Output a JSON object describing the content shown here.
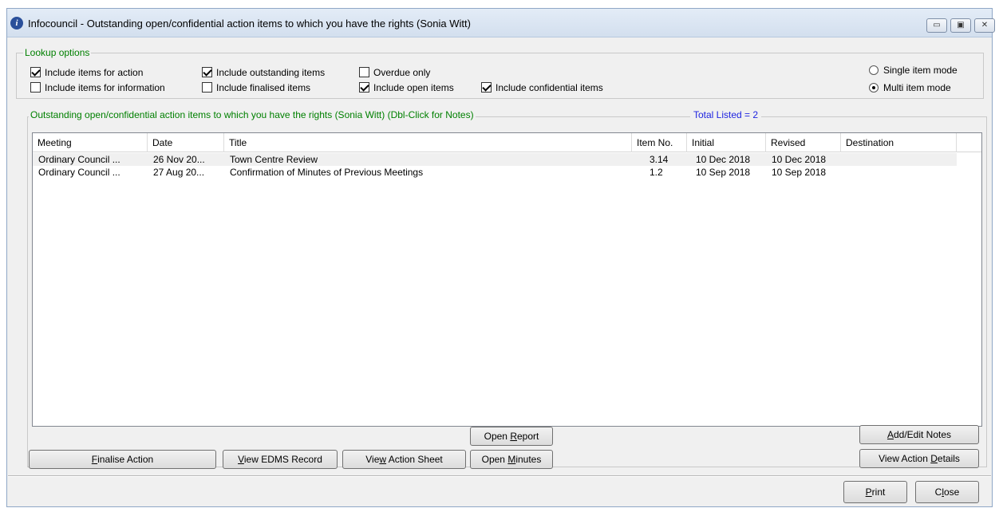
{
  "window": {
    "title": "Infocouncil - Outstanding open/confidential action items to which you have the rights (Sonia Witt)",
    "icon": "info-icon",
    "controls": {
      "minimize": "▭",
      "maximize": "▣",
      "close": "✕"
    }
  },
  "lookup": {
    "legend": "Lookup options",
    "options": [
      {
        "label": "Include items for action",
        "checked": true
      },
      {
        "label": "Include items for information",
        "checked": false
      },
      {
        "label": "Include outstanding items",
        "checked": true
      },
      {
        "label": "Include finalised items",
        "checked": false
      },
      {
        "label": "Overdue only",
        "checked": false
      },
      {
        "label": "Include open items",
        "checked": true
      },
      {
        "label": "Include confidential items",
        "checked": true
      }
    ],
    "modes": [
      {
        "label": "Single item mode",
        "selected": false
      },
      {
        "label": "Multi item mode",
        "selected": true
      }
    ]
  },
  "list": {
    "legend": "Outstanding open/confidential action items to which you have the rights (Sonia Witt) (Dbl-Click for Notes)",
    "total": "Total Listed = 2",
    "columns": [
      "Meeting",
      "Date",
      "Title",
      "Item No.",
      "Initial",
      "Revised",
      "Destination"
    ],
    "rows": [
      {
        "meeting": "Ordinary Council ...",
        "date": "26 Nov 20...",
        "title": "Town Centre Review",
        "item_no": "3.14",
        "initial": "10 Dec 2018",
        "revised": "10 Dec 2018",
        "destination": ""
      },
      {
        "meeting": "Ordinary Council ...",
        "date": "27 Aug 20...",
        "title": "Confirmation of Minutes of Previous Meetings",
        "item_no": "1.2",
        "initial": "10 Sep 2018",
        "revised": "10 Sep 2018",
        "destination": ""
      }
    ]
  },
  "buttons": {
    "finalise_pre": "",
    "finalise_key": "F",
    "finalise_post": "inalise Action",
    "edms_pre": "",
    "edms_key": "V",
    "edms_post": "iew EDMS Record",
    "sheet_pre": "Vie",
    "sheet_key": "w",
    "sheet_post": " Action Sheet",
    "report_pre": "Open ",
    "report_key": "R",
    "report_post": "eport",
    "minutes_pre": "Open ",
    "minutes_key": "M",
    "minutes_post": "inutes",
    "notes_pre": "",
    "notes_key": "A",
    "notes_post": "dd/Edit Notes",
    "details_pre": "View Action ",
    "details_key": "D",
    "details_post": "etails",
    "print_pre": "",
    "print_key": "P",
    "print_post": "rint",
    "close_pre": "C",
    "close_key": "l",
    "close_post": "ose"
  }
}
